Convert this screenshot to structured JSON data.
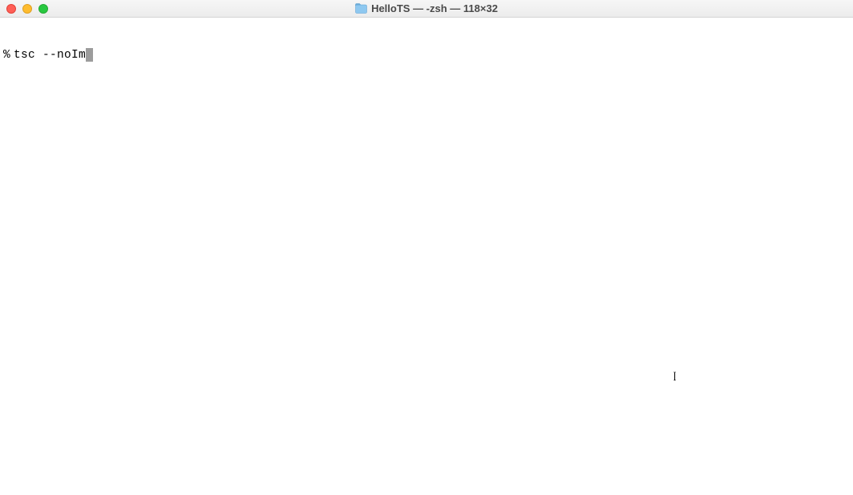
{
  "titlebar": {
    "title": "HelloTS — -zsh — 118×32",
    "icon_name": "folder-icon"
  },
  "terminal": {
    "prompt": "%",
    "command": "tsc --noIm"
  },
  "cursor": {
    "ibeam_glyph": "I"
  }
}
